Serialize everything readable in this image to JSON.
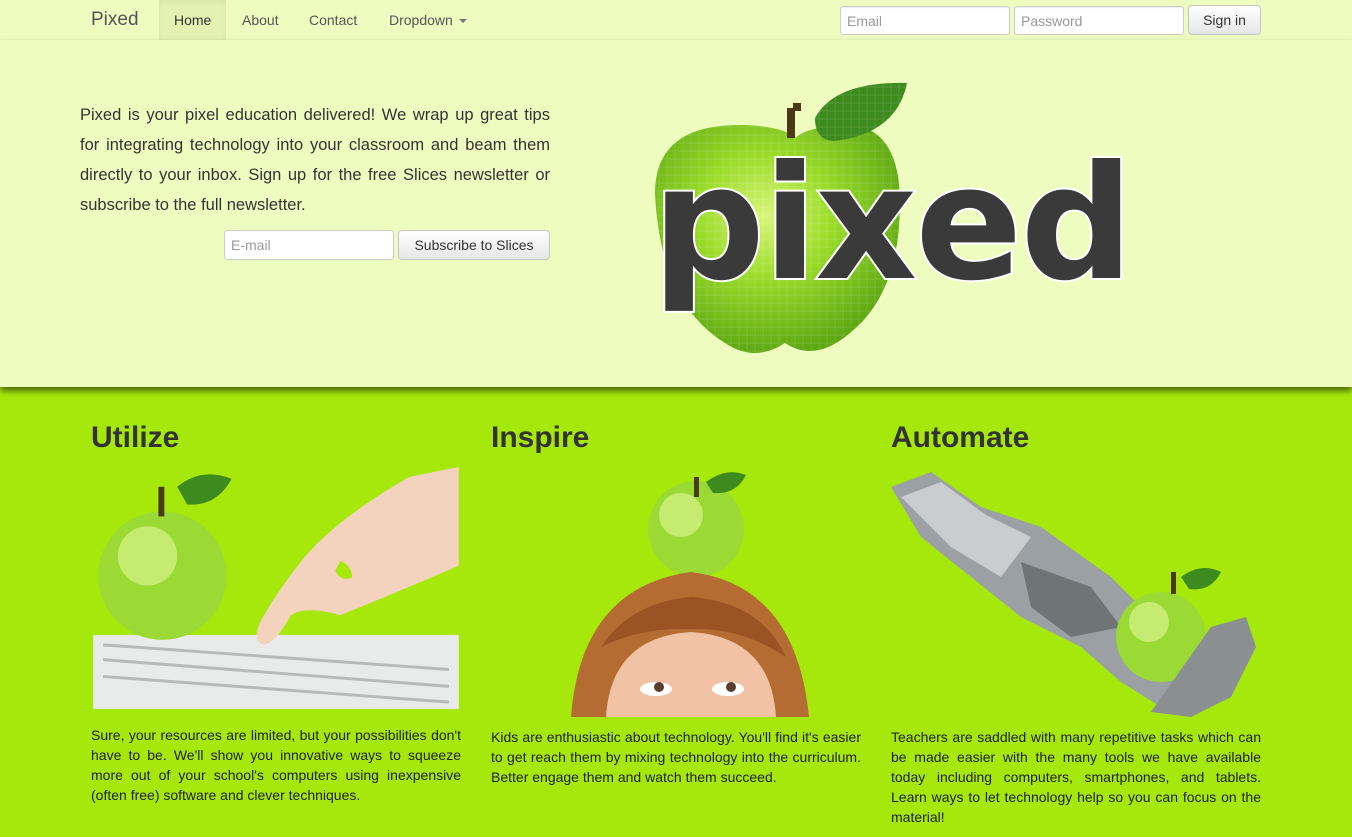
{
  "navbar": {
    "brand": "Pixed",
    "items": [
      {
        "label": "Home",
        "active": true
      },
      {
        "label": "About"
      },
      {
        "label": "Contact"
      },
      {
        "label": "Dropdown"
      }
    ],
    "email_placeholder": "Email",
    "password_placeholder": "Password",
    "signin_label": "Sign in"
  },
  "hero": {
    "text": "Pixed is your pixel education delivered! We wrap up great tips for integrating technology into your classroom and beam them directly to your inbox. Sign up for the free Slices newsletter or subscribe to the full newsletter.",
    "email_placeholder": "E-mail",
    "subscribe_label": "Subscribe to Slices",
    "logo_word": "pixed"
  },
  "columns": [
    {
      "title": "Utilize",
      "text": "Sure, your resources are limited, but your possibilities don't have to be. We'll show you innovative ways to squeeze more out of your school's computers using inexpensive (often free) software and clever techniques."
    },
    {
      "title": "Inspire",
      "text": "Kids are enthusiastic about technology. You'll find it's easier to get reach them by mixing technology into the curriculum. Better engage them and watch them succeed."
    },
    {
      "title": "Automate",
      "text": "Teachers are saddled with many repetitive tasks which can be made easier with the many tools we have available today including computers, smartphones, and tablets. Learn ways to let technology help so you can focus on the material!"
    }
  ],
  "colors": {
    "background": "#a6e80b",
    "hero_bg": "#eefcc0",
    "apple_green": "#8fd11c",
    "text": "#333333"
  }
}
